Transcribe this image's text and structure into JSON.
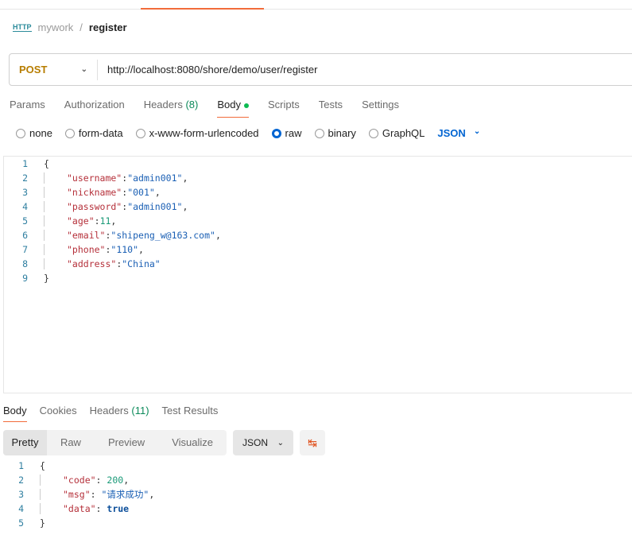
{
  "breadcrumb": {
    "icon": "http-icon",
    "icon_text": "HTTP",
    "workspace": "mywork",
    "separator": "/",
    "request": "register"
  },
  "request": {
    "method": "POST",
    "url": "http://localhost:8080/shore/demo/user/register"
  },
  "tabs": [
    {
      "label": "Params"
    },
    {
      "label": "Authorization"
    },
    {
      "label": "Headers",
      "count": "(8)"
    },
    {
      "label": "Body",
      "active": true
    },
    {
      "label": "Scripts"
    },
    {
      "label": "Tests"
    },
    {
      "label": "Settings"
    }
  ],
  "body_types": [
    {
      "label": "none"
    },
    {
      "label": "form-data"
    },
    {
      "label": "x-www-form-urlencoded"
    },
    {
      "label": "raw",
      "selected": true
    },
    {
      "label": "binary"
    },
    {
      "label": "GraphQL"
    }
  ],
  "raw_format": "JSON",
  "request_body": [
    {
      "n": "1",
      "tokens": [
        [
          "p",
          "{"
        ]
      ]
    },
    {
      "n": "2",
      "tokens": [
        [
          "k",
          "\"username\""
        ],
        [
          "p",
          ":"
        ],
        [
          "s",
          "\"admin001\""
        ],
        [
          "p",
          ","
        ]
      ]
    },
    {
      "n": "3",
      "tokens": [
        [
          "k",
          "\"nickname\""
        ],
        [
          "p",
          ":"
        ],
        [
          "s",
          "\"001\""
        ],
        [
          "p",
          ","
        ]
      ]
    },
    {
      "n": "4",
      "tokens": [
        [
          "k",
          "\"password\""
        ],
        [
          "p",
          ":"
        ],
        [
          "s",
          "\"admin001\""
        ],
        [
          "p",
          ","
        ]
      ]
    },
    {
      "n": "5",
      "tokens": [
        [
          "k",
          "\"age\""
        ],
        [
          "p",
          ":"
        ],
        [
          "n",
          "11"
        ],
        [
          "p",
          ","
        ]
      ]
    },
    {
      "n": "6",
      "tokens": [
        [
          "k",
          "\"email\""
        ],
        [
          "p",
          ":"
        ],
        [
          "s",
          "\"shipeng_w@163.com\""
        ],
        [
          "p",
          ","
        ]
      ]
    },
    {
      "n": "7",
      "tokens": [
        [
          "k",
          "\"phone\""
        ],
        [
          "p",
          ":"
        ],
        [
          "s",
          "\"110\""
        ],
        [
          "p",
          ","
        ]
      ]
    },
    {
      "n": "8",
      "tokens": [
        [
          "k",
          "\"address\""
        ],
        [
          "p",
          ":"
        ],
        [
          "s",
          "\"China\""
        ]
      ]
    },
    {
      "n": "9",
      "tokens": [
        [
          "p",
          "}"
        ]
      ]
    }
  ],
  "response_tabs": [
    {
      "label": "Body",
      "active": true
    },
    {
      "label": "Cookies"
    },
    {
      "label": "Headers",
      "count": "(11)"
    },
    {
      "label": "Test Results"
    }
  ],
  "view_modes": [
    {
      "label": "Pretty",
      "active": true
    },
    {
      "label": "Raw"
    },
    {
      "label": "Preview"
    },
    {
      "label": "Visualize"
    }
  ],
  "response_format": "JSON",
  "response_body": [
    {
      "n": "1",
      "tokens": [
        [
          "p",
          "{"
        ]
      ]
    },
    {
      "n": "2",
      "tokens": [
        [
          "k",
          "\"code\""
        ],
        [
          "p",
          ": "
        ],
        [
          "n",
          "200"
        ],
        [
          "p",
          ","
        ]
      ]
    },
    {
      "n": "3",
      "tokens": [
        [
          "k",
          "\"msg\""
        ],
        [
          "p",
          ": "
        ],
        [
          "s",
          "\"请求成功\""
        ],
        [
          "p",
          ","
        ]
      ]
    },
    {
      "n": "4",
      "tokens": [
        [
          "k",
          "\"data\""
        ],
        [
          "p",
          ": "
        ],
        [
          "b",
          "true"
        ]
      ]
    },
    {
      "n": "5",
      "tokens": [
        [
          "p",
          "}"
        ]
      ]
    }
  ],
  "colors": {
    "accent": "#f26b3a",
    "method": "#b77d00",
    "link": "#0265d2"
  }
}
